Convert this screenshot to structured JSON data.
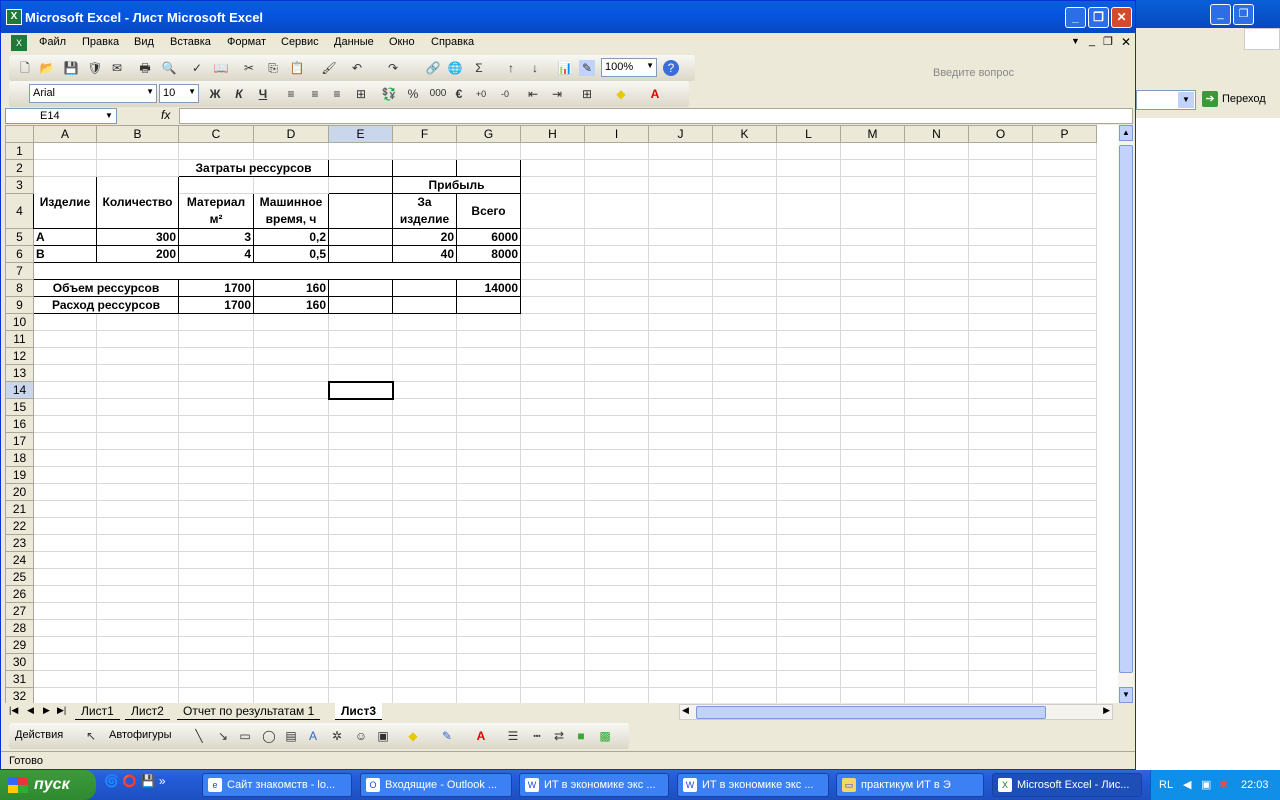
{
  "window": {
    "title": "Microsoft Excel - Лист Microsoft Excel"
  },
  "menu": [
    "Файл",
    "Правка",
    "Вид",
    "Вставка",
    "Формат",
    "Сервис",
    "Данные",
    "Окно",
    "Справка"
  ],
  "ask_placeholder": "Введите вопрос",
  "toolbar": {
    "zoom": "100%",
    "font": "Arial",
    "size": "10",
    "bold": "Ж",
    "italic": "К",
    "underline": "Ч",
    "percent": "%",
    "thousands": "000",
    "euro": "€",
    "sigma": "Σ"
  },
  "namebox": "E14",
  "fx": "fx",
  "columns": [
    "A",
    "B",
    "C",
    "D",
    "E",
    "F",
    "G",
    "H",
    "I",
    "J",
    "K",
    "L",
    "M",
    "N",
    "O",
    "P"
  ],
  "rows": [
    "1",
    "2",
    "3",
    "4",
    "5",
    "6",
    "7",
    "8",
    "9",
    "10",
    "11",
    "12",
    "13",
    "14",
    "15",
    "16",
    "17",
    "18",
    "19",
    "20",
    "21",
    "22",
    "23",
    "24",
    "25",
    "26",
    "27",
    "28",
    "29",
    "30",
    "31",
    "32"
  ],
  "cells": {
    "C2": "Затраты рессурсов",
    "A3": "Изделие",
    "B3": "Количество",
    "F3": "Прибыль",
    "C4a": "Материал",
    "C4b": "м²",
    "D4a": "Машинное",
    "D4b": "время, ч",
    "F4a": "За",
    "F4b": "изделие",
    "G4": "Всего",
    "A5": "A",
    "B5": "300",
    "C5": "3",
    "D5": "0,2",
    "F5": "20",
    "G5": "6000",
    "A6": "B",
    "B6": "200",
    "C6": "4",
    "D6": "0,5",
    "F6": "40",
    "G6": "8000",
    "A8": "Объем рессурсов",
    "C8": "1700",
    "D8": "160",
    "G8": "14000",
    "A9": "Расход рессурсов",
    "C9": "1700",
    "D9": "160"
  },
  "sheets": [
    "Лист1",
    "Лист2",
    "Отчет по результатам 1",
    "Лист3"
  ],
  "drawbar": {
    "actions": "Действия",
    "autoshapes": "Автофигуры"
  },
  "status": "Готово",
  "bgwindow": {
    "go": "Переход"
  },
  "taskbar": {
    "start": "пуск",
    "tasks": [
      "Сайт знакомств - lo...",
      "Входящие - Outlook ...",
      "ИТ в экономике экс ...",
      "ИТ в экономике экс ...",
      "практикум ИТ в Э",
      "Microsoft Excel - Лис..."
    ],
    "lang": "RL",
    "clock": "22:03"
  }
}
